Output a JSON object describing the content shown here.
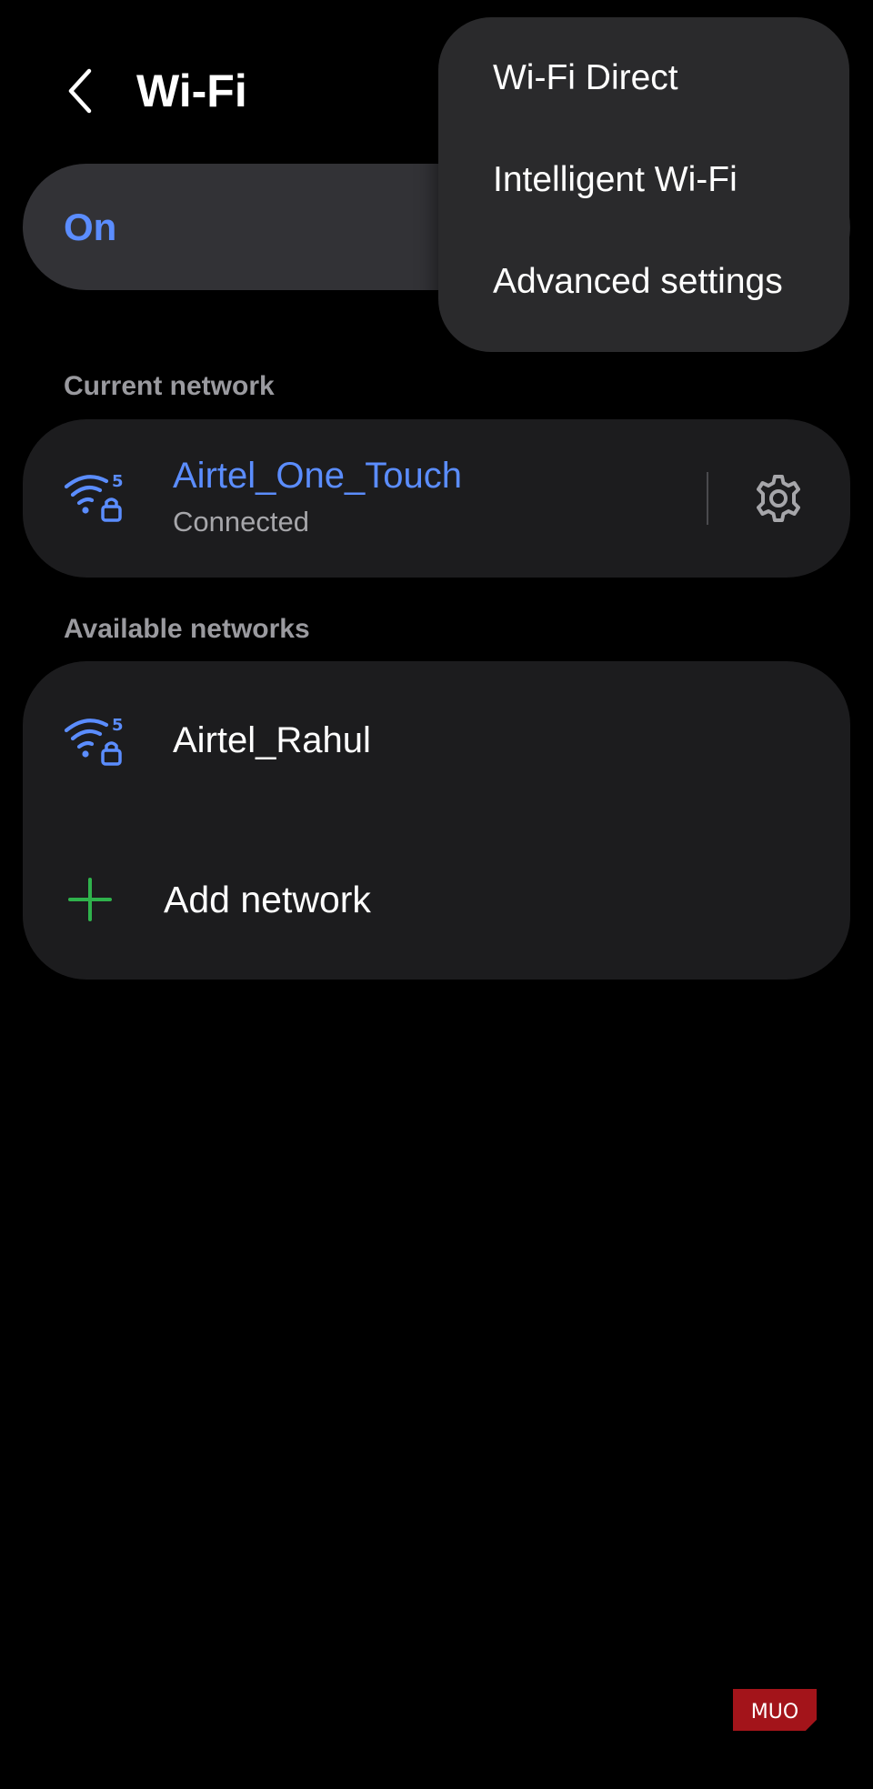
{
  "header": {
    "title": "Wi-Fi"
  },
  "master_toggle": {
    "label": "On",
    "state": "on"
  },
  "current_network": {
    "section_label": "Current network",
    "name": "Airtel_One_Touch",
    "status": "Connected",
    "band": "5",
    "icon": "wifi-5ghz-locked-icon"
  },
  "available_networks": {
    "section_label": "Available networks",
    "items": [
      {
        "name": "Airtel_Rahul",
        "band": "5",
        "icon": "wifi-5ghz-locked-icon"
      }
    ],
    "add_label": "Add network"
  },
  "overflow_menu": {
    "items": [
      {
        "label": "Wi-Fi Direct"
      },
      {
        "label": "Intelligent Wi-Fi"
      },
      {
        "label": "Advanced settings"
      }
    ]
  },
  "watermark": {
    "text": "MUO"
  },
  "colors": {
    "accent": "#5b8dff",
    "card_background": "#1c1c1e",
    "menu_background": "#2a2a2c",
    "add_icon": "#2fb24c",
    "watermark": "#a3141a"
  }
}
